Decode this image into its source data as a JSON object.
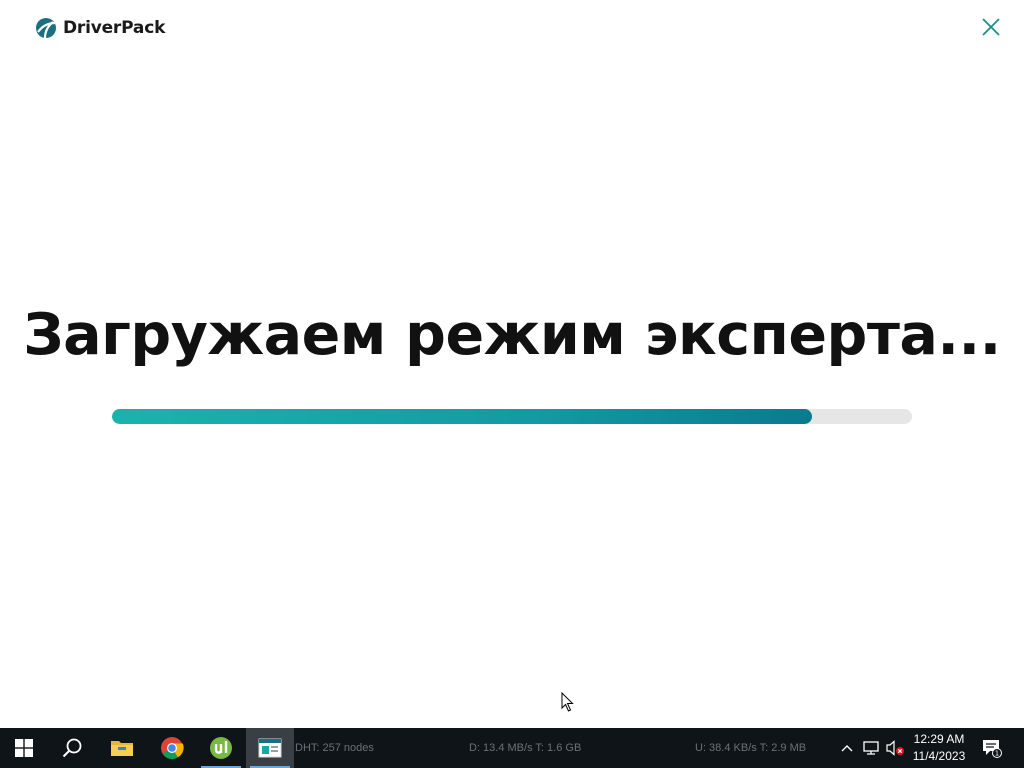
{
  "app": {
    "brand": "DriverPack",
    "brand_color": "#1b6f7e",
    "accent_color": "#17a9a6",
    "headline": "Загружаем режим эксперта...",
    "progress": 0.875,
    "close_icon": "close-icon"
  },
  "taskbar": {
    "icons": [
      "windows-start-icon",
      "search-icon",
      "file-explorer-icon",
      "chrome-icon",
      "utorrent-icon",
      "app-window-icon"
    ],
    "status": {
      "dht": "DHT: 257 nodes",
      "download": "D: 13.4 MB/s T: 1.6 GB",
      "upload": "U: 38.4 KB/s T: 2.9 MB"
    },
    "tray_icons": [
      "chevron-up-icon",
      "network-icon",
      "volume-muted-icon"
    ],
    "clock": {
      "time": "12:29 AM",
      "date": "11/4/2023"
    },
    "notification_count": "1"
  }
}
